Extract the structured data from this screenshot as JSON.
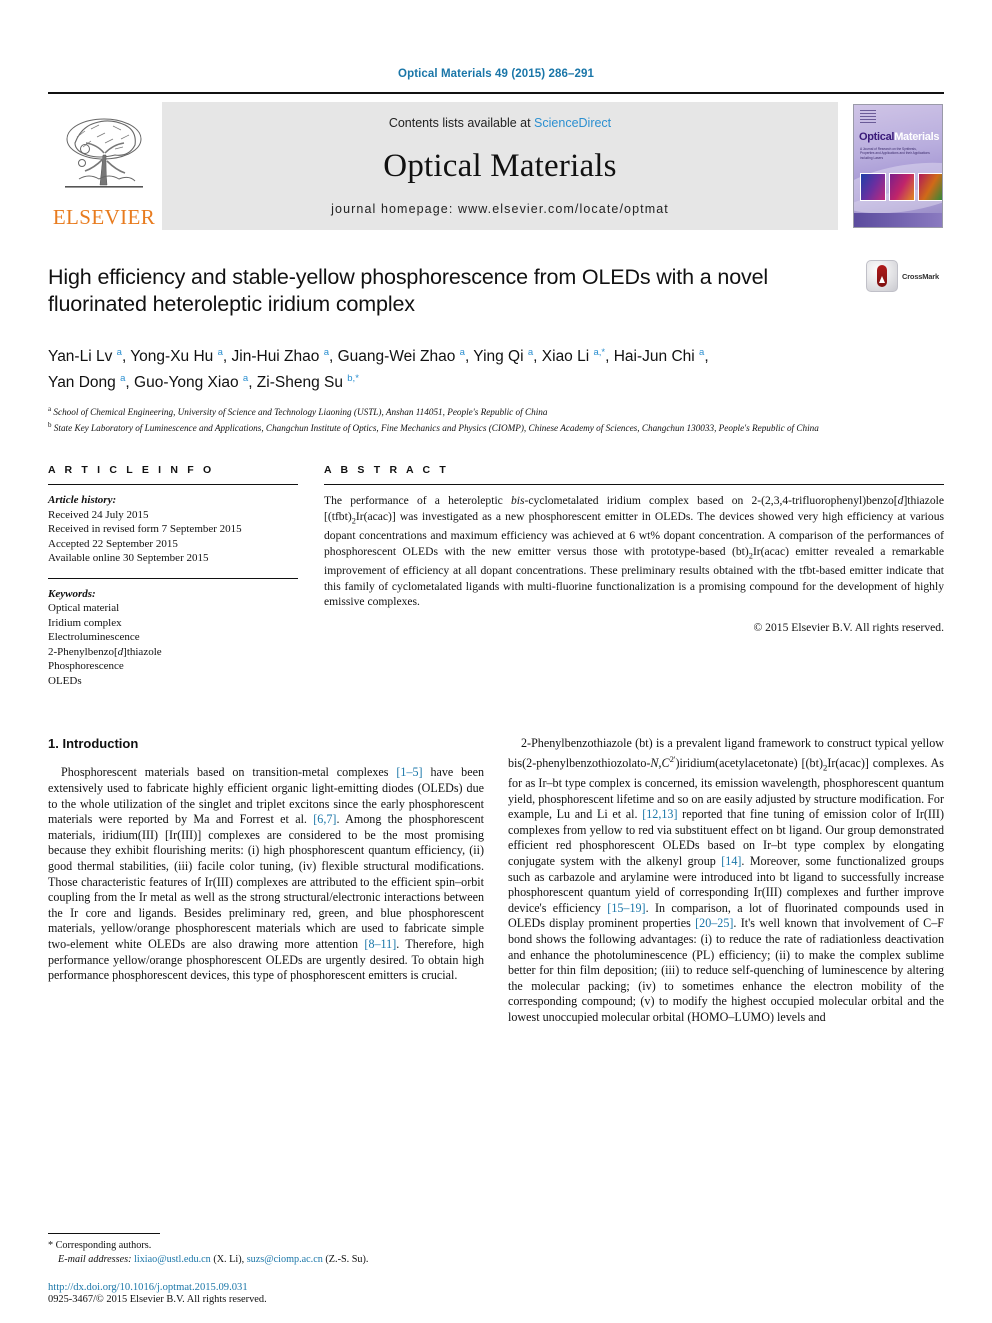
{
  "running_head": "Optical Materials 49 (2015) 286–291",
  "masthead": {
    "publisher": "ELSEVIER",
    "contents_prefix": "Contents lists available at ",
    "contents_link": "ScienceDirect",
    "journal_name": "Optical Materials",
    "homepage": "journal homepage: www.elsevier.com/locate/optmat",
    "cover": {
      "title_part1": "Optical",
      "title_part2": "Materials",
      "subtitle": "A Journal of Research on the Synthesis, Properties and Applications and their Applications including Lasers"
    }
  },
  "article": {
    "title": "High efficiency and stable-yellow phosphorescence from OLEDs with a novel fluorinated heteroleptic iridium complex",
    "crossmark_label": "CrossMark",
    "authors_line1": "Yan-Li Lv a, Yong-Xu Hu a, Jin-Hui Zhao a, Guang-Wei Zhao a, Ying Qi a, Xiao Li a,*, Hai-Jun Chi a,",
    "authors_line2": "Yan Dong a, Guo-Yong Xiao a, Zi-Sheng Su b,*",
    "affiliation_a": "School of Chemical Engineering, University of Science and Technology Liaoning (USTL), Anshan 114051, People's Republic of China",
    "affiliation_b": "State Key Laboratory of Luminescence and Applications, Changchun Institute of Optics, Fine Mechanics and Physics (CIOMP), Chinese Academy of Sciences, Changchun 130033, People's Republic of China"
  },
  "article_info": {
    "heading": "A R T I C L E   I N F O",
    "history_label": "Article history:",
    "history": [
      "Received 24 July 2015",
      "Received in revised form 7 September 2015",
      "Accepted 22 September 2015",
      "Available online 30 September 2015"
    ],
    "keywords_label": "Keywords:",
    "keywords": [
      "Optical material",
      "Iridium complex",
      "Electroluminescence",
      "2-Phenylbenzo[d]thiazole",
      "Phosphorescence",
      "OLEDs"
    ]
  },
  "abstract": {
    "heading": "A B S T R A C T",
    "text": "The performance of a heteroleptic bis-cyclometalated iridium complex based on 2-(2,3,4-trifluorophenyl)benzo[d]thiazole [(tfbt)2Ir(acac)] was investigated as a new phosphorescent emitter in OLEDs. The devices showed very high efficiency at various dopant concentrations and maximum efficiency was achieved at 6 wt% dopant concentration. A comparison of the performances of phosphorescent OLEDs with the new emitter versus those with prototype-based (bt)2Ir(acac) emitter revealed a remarkable improvement of efficiency at all dopant concentrations. These preliminary results obtained with the tfbt-based emitter indicate that this family of cyclometalated ligands with multi-fluorine functionalization is a promising compound for the development of highly emissive complexes.",
    "copyright": "© 2015 Elsevier B.V. All rights reserved."
  },
  "body": {
    "section_heading": "1. Introduction",
    "left_paragraph": "Phosphorescent materials based on transition-metal complexes [1–5] have been extensively used to fabricate highly efficient organic light-emitting diodes (OLEDs) due to the whole utilization of the singlet and triplet excitons since the early phosphorescent materials were reported by Ma and Forrest et al. [6,7]. Among the phosphorescent materials, iridium(III) [Ir(III)] complexes are considered to be the most promising because they exhibit flourishing merits: (i) high phosphorescent quantum efficiency, (ii) good thermal stabilities, (iii) facile color tuning, (iv) flexible structural modifications. Those characteristic features of Ir(III) complexes are attributed to the efficient spin–orbit coupling from the Ir metal as well as the strong structural/electronic interactions between the Ir core and ligands. Besides preliminary red, green, and blue phosphorescent materials, yellow/orange phosphorescent materials which are used to fabricate simple two-element white OLEDs are also drawing more attention [8–11]. Therefore, high performance yellow/orange phosphorescent OLEDs are urgently desired. To obtain high performance phosphorescent devices, this type of phosphorescent emitters is crucial.",
    "right_paragraph": "2-Phenylbenzothiazole (bt) is a prevalent ligand framework to construct typical yellow bis(2-phenylbenzothiozolato-N,C2')iridium(acetylacetonate) [(bt)2Ir(acac)] complexes. As for as Ir–bt type complex is concerned, its emission wavelength, phosphorescent quantum yield, phosphorescent lifetime and so on are easily adjusted by structure modification. For example, Lu and Li et al. [12,13] reported that fine tuning of emission color of Ir(III) complexes from yellow to red via substituent effect on bt ligand. Our group demonstrated efficient red phosphorescent OLEDs based on Ir–bt type complex by elongating conjugate system with the alkenyl group [14]. Moreover, some functionalized groups such as carbazole and arylamine were introduced into bt ligand to successfully increase phosphorescent quantum yield of corresponding Ir(III) complexes and further improve device's efficiency [15–19]. In comparison, a lot of fluorinated compounds used in OLEDs display prominent properties [20–25]. It's well known that involvement of C–F bond shows the following advantages: (i) to reduce the rate of radiationless deactivation and enhance the photoluminescence (PL) efficiency; (ii) to make the complex sublime better for thin film deposition; (iii) to reduce self-quenching of luminescence by altering the molecular packing; (iv) to sometimes enhance the electron mobility of the corresponding compound; (v) to modify the highest occupied molecular orbital and the lowest unoccupied molecular orbital (HOMO–LUMO) levels and"
  },
  "footnotes": {
    "corresponding_marker": "*",
    "corresponding_text": "Corresponding authors.",
    "email_label": "E-mail addresses:",
    "email_1": "lixiao@ustl.edu.cn",
    "email_1_owner": "(X. Li),",
    "email_2": "suzs@ciomp.ac.cn",
    "email_2_owner": "(Z.-S. Su).",
    "doi": "http://dx.doi.org/10.1016/j.optmat.2015.09.031",
    "issn_line": "0925-3467/© 2015 Elsevier B.V. All rights reserved."
  },
  "colors": {
    "link": "#1a76a8",
    "science_direct": "#2b8fd0",
    "elsevier_orange": "#E87B1E"
  }
}
